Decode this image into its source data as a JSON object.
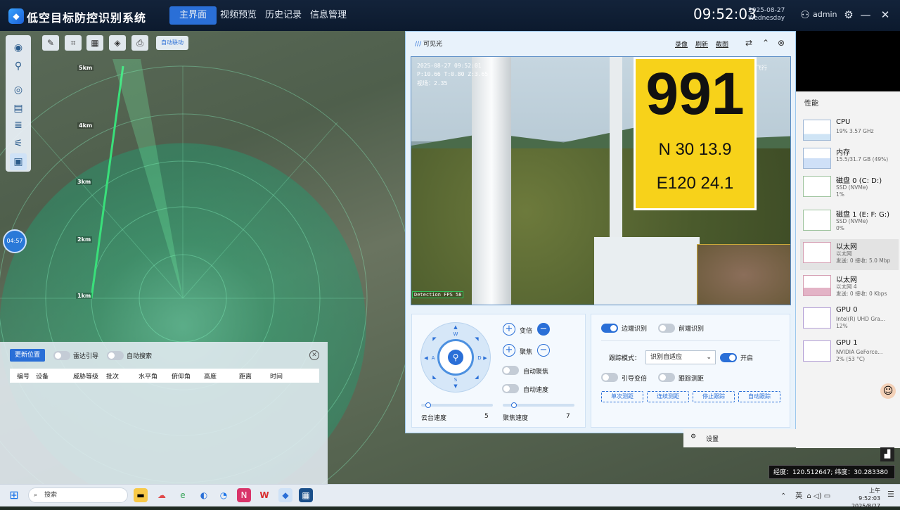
{
  "app": {
    "title": "低空目标防控识别系统",
    "nav": [
      "主界面",
      "视频预览",
      "历史记录",
      "信息管理"
    ],
    "active_nav": "主界面",
    "time": "09:52:03",
    "date": "2025-08-27",
    "weekday": "Wednesday",
    "user": "admin"
  },
  "map": {
    "auto_link": "自动联动",
    "range_labels": [
      "5km",
      "4km",
      "3km",
      "2km",
      "1km"
    ],
    "timer": "04:57",
    "coordinates": "经度：120.512647;  纬度：30.283380"
  },
  "panel": {
    "update_position": "更新位置",
    "radar_guide": "雷达引导",
    "auto_search": "自动搜索",
    "columns": [
      "编号",
      "设备",
      "威胁等级",
      "批次",
      "水平角",
      "俯仰角",
      "高度",
      "距离",
      "时间"
    ]
  },
  "video": {
    "title": "可见光",
    "actions": [
      "录像",
      "刷新",
      "截图"
    ],
    "osd_line1": "2025-08-27 09:52:01",
    "osd_line2": "P:10.66 T:0.80 Z:3.65",
    "osd_line3": "视场：2.35",
    "osd_right": "飞行",
    "detection": "Detection FPS 58",
    "sign_number": "991",
    "sign_n": "N 30 13.9",
    "sign_e": "E120 24.1"
  },
  "ptz": {
    "zoom": "变倍",
    "focus": "聚焦",
    "auto_focus": "自动聚焦",
    "auto_speed": "自动速度",
    "ptz_speed_label": "云台速度",
    "ptz_speed": "5",
    "focus_speed_label": "聚焦速度",
    "focus_speed": "7",
    "dirs": {
      "w": "W",
      "a": "A",
      "s": "S",
      "d": "D"
    }
  },
  "tracking": {
    "edge_detect": "边端识别",
    "front_detect": "前端识别",
    "mode_label": "跟踪模式：",
    "mode_value": "识别自适应",
    "enable": "开启",
    "guide_zoom": "引导变倍",
    "track_range": "跟踪测距",
    "buttons": [
      "单次测距",
      "连续测距",
      "停止跟踪",
      "自动跟踪"
    ]
  },
  "perf": {
    "title": "性能",
    "settings": "设置",
    "items": [
      {
        "name": "CPU",
        "sub": "19% 3.57 GHz"
      },
      {
        "name": "内存",
        "sub": "15.5/31.7 GB (49%)"
      },
      {
        "name": "磁盘 0 (C: D:)",
        "sub": "SSD (NVMe)\n1%"
      },
      {
        "name": "磁盘 1 (E: F: G:)",
        "sub": "SSD (NVMe)\n0%"
      },
      {
        "name": "以太网",
        "sub": "以太网\n发送: 0 接收: 5.0 Mbp"
      },
      {
        "name": "以太网",
        "sub": "以太网 4\n发送: 0 接收: 0 Kbps"
      },
      {
        "name": "GPU 0",
        "sub": "Intel(R) UHD Gra...\n12%"
      },
      {
        "name": "GPU 1",
        "sub": "NVIDIA GeForce...\n2% (53 °C)"
      }
    ]
  },
  "taskbar": {
    "search": "搜索",
    "ime": "英",
    "time": "上午 9:52:03",
    "date": "2025/8/27"
  },
  "colors": {
    "accent": "#2a6fd7",
    "topbar": "#13233a",
    "radar": "#3fc08a"
  }
}
